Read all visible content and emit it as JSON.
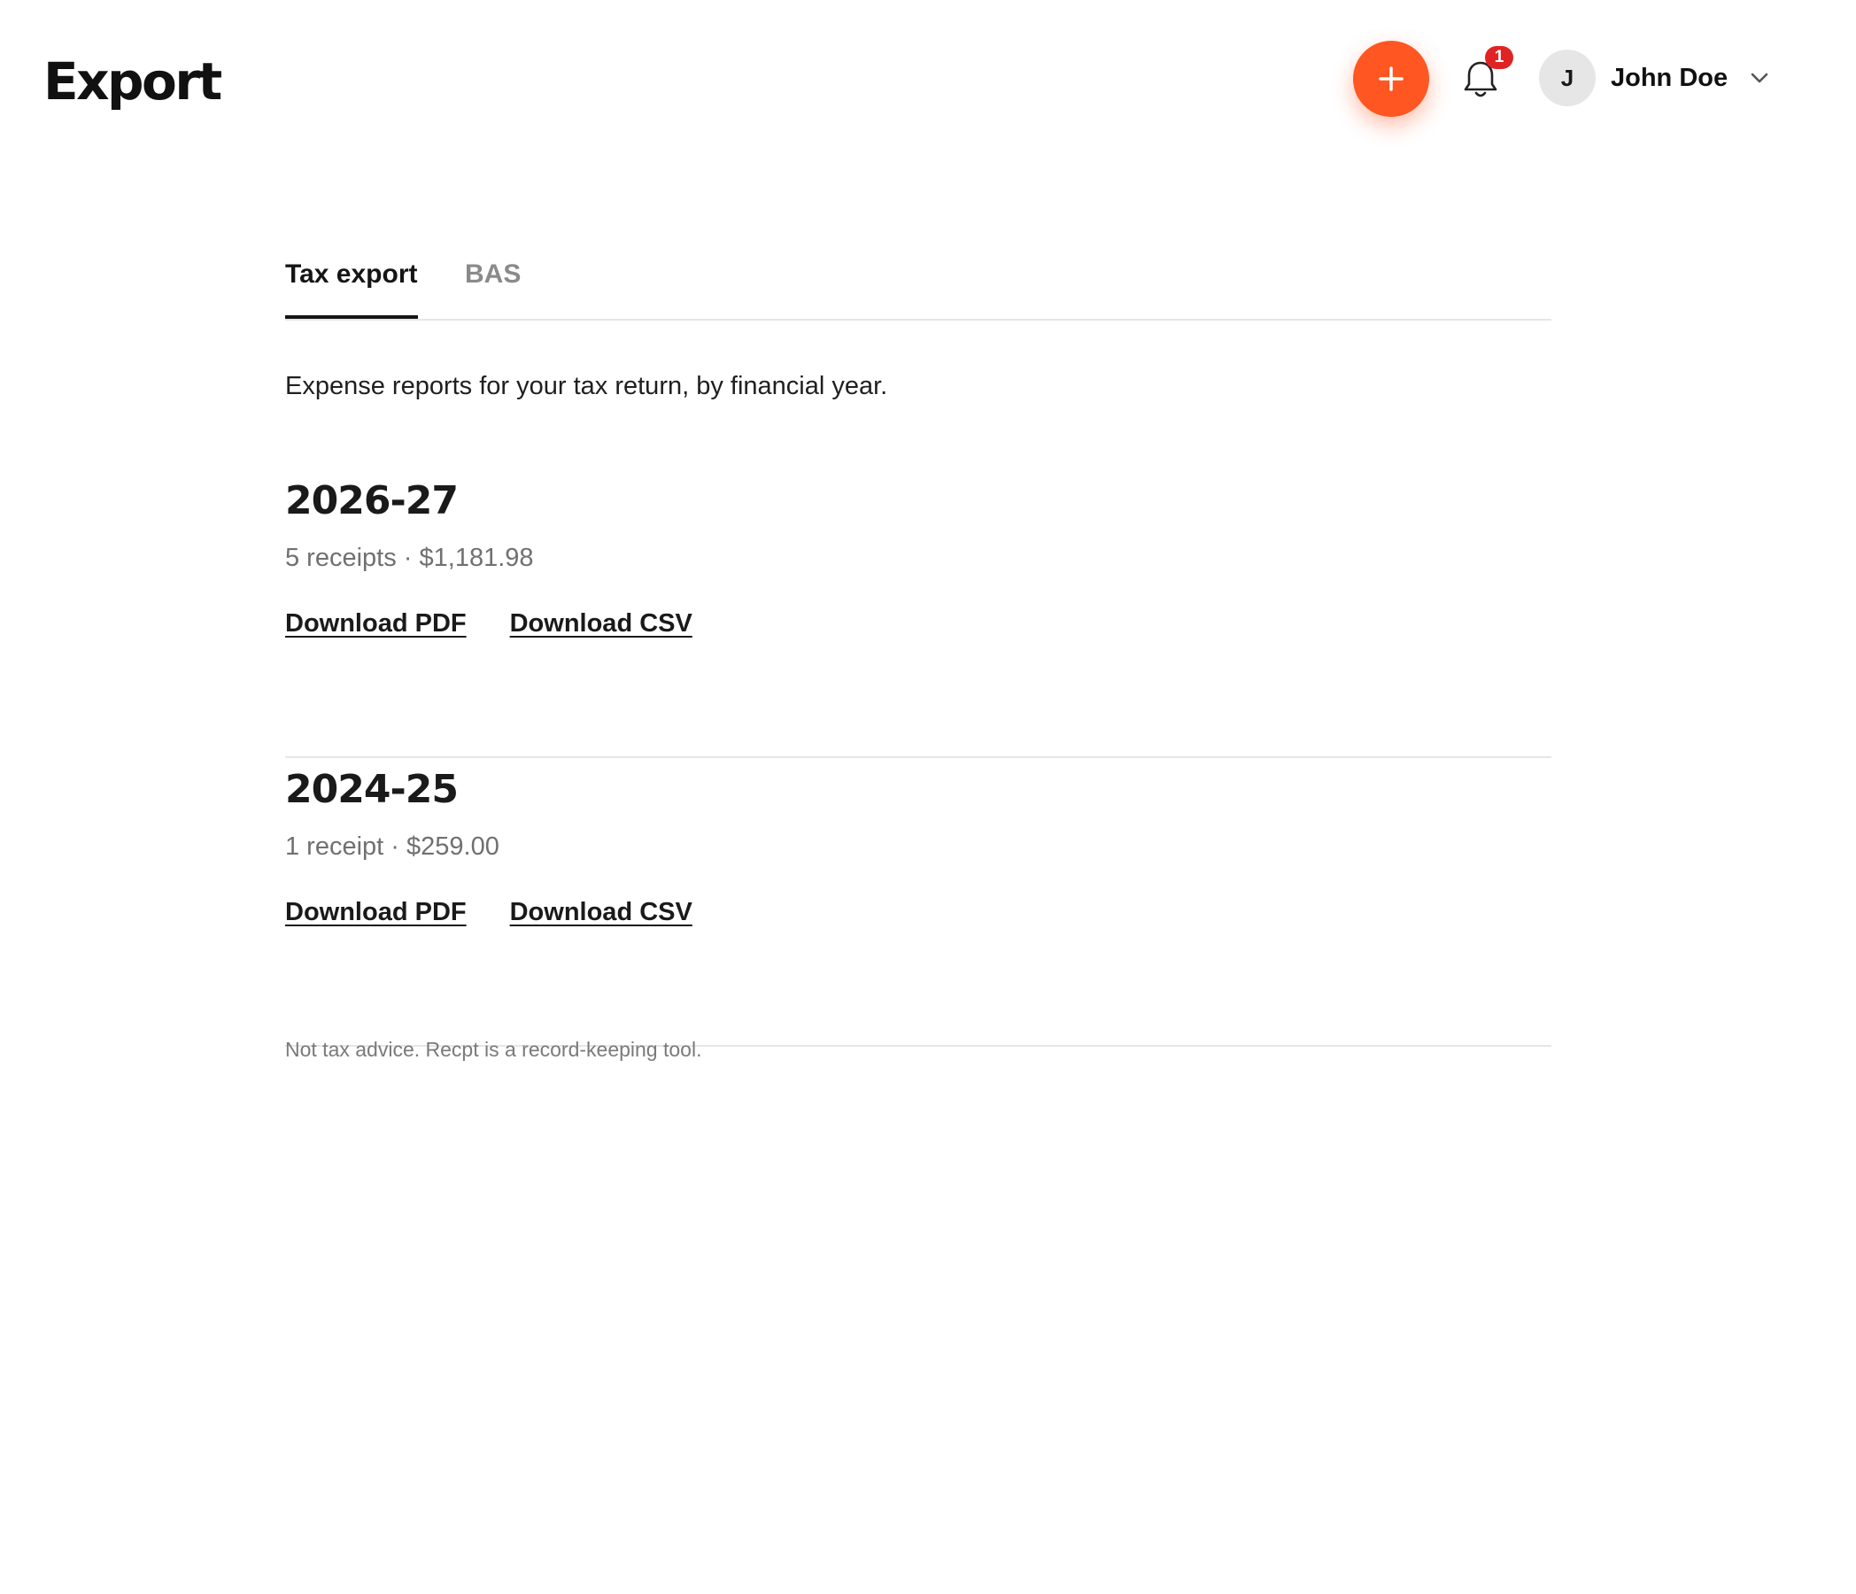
{
  "header": {
    "title": "Export",
    "notifications": {
      "count": "1"
    },
    "user": {
      "initial": "J",
      "name": "John Doe"
    }
  },
  "icons": {
    "add": "plus-icon",
    "notifications": "bell-icon",
    "user_menu": "chevron-down-icon"
  },
  "colors": {
    "accent": "#ff5622",
    "badge": "#e02424",
    "text_primary": "#1a1a1a",
    "text_muted": "#707070",
    "divider": "#e6e6e6"
  },
  "tabs": [
    {
      "label": "Tax export",
      "active": true
    },
    {
      "label": "BAS",
      "active": false
    }
  ],
  "intro": "Expense reports for your tax return, by financial year.",
  "years": [
    {
      "label": "2026-27",
      "summary": "5 receipts · $1,181.98",
      "pdf_label": "Download PDF",
      "csv_label": "Download CSV"
    },
    {
      "label": "2024-25",
      "summary": "1 receipt · $259.00",
      "pdf_label": "Download PDF",
      "csv_label": "Download CSV"
    }
  ],
  "disclaimer": "Not tax advice. Recpt is a record-keeping tool."
}
